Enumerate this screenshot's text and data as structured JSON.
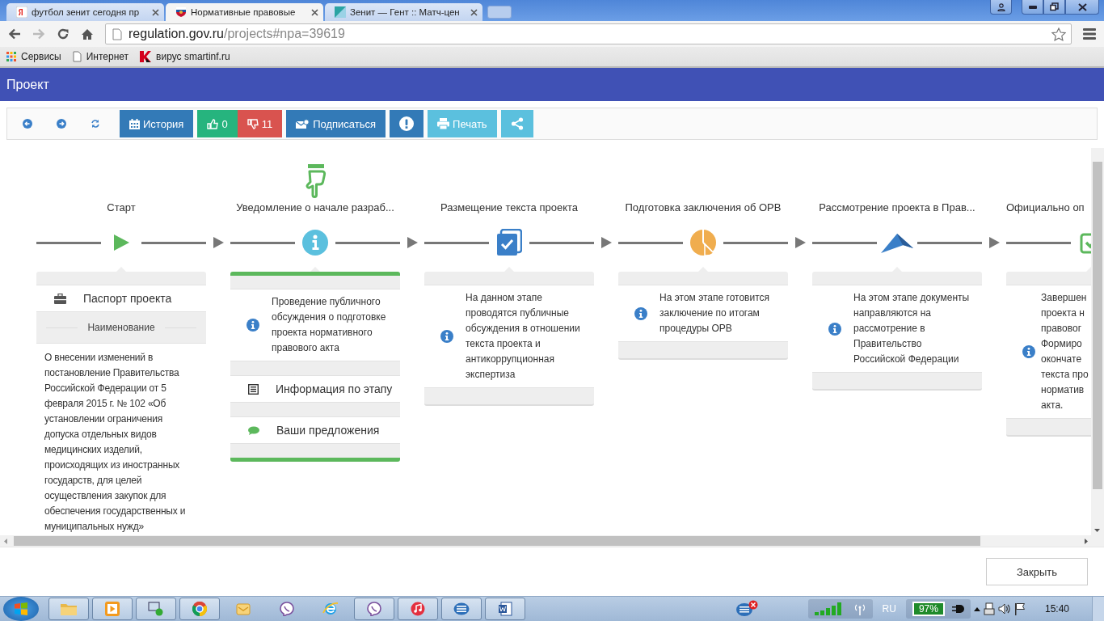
{
  "browser": {
    "tabs": [
      {
        "title": "футбол зенит сегодня пр",
        "selected": false
      },
      {
        "title": "Нормативные правовые",
        "selected": true
      },
      {
        "title": "Зенит — Гент :: Матч-цен",
        "selected": false
      }
    ],
    "url_host": "regulation.gov.ru",
    "url_path": "/projects#npa=39619",
    "bookmarks": [
      {
        "label": "Сервисы",
        "kind": "apps"
      },
      {
        "label": "Интернет",
        "kind": "page"
      },
      {
        "label": "вирус smartinf.ru",
        "kind": "kaspersky"
      }
    ]
  },
  "header": {
    "title": "Проект"
  },
  "toolbar": [
    {
      "kind": "back"
    },
    {
      "kind": "forward"
    },
    {
      "kind": "refresh"
    },
    {
      "kind": "history",
      "label": "История"
    },
    {
      "kind": "like",
      "label": "0"
    },
    {
      "kind": "dislike",
      "label": "11"
    },
    {
      "kind": "subscribe",
      "label": "Подписаться"
    },
    {
      "kind": "alert"
    },
    {
      "kind": "print",
      "label": "Печать"
    },
    {
      "kind": "share"
    }
  ],
  "stages": [
    {
      "title": "Старт",
      "current": false,
      "card": {
        "kind": "passport",
        "heading": "Паспорт проекта",
        "section": "Наименование",
        "text": "О внесении изменений в постановление Правительства Российской Федерации от 5 февраля 2015 г. № 102 «Об установлении ограничения допуска отдельных видов медицинских изделий, происходящих из иностранных государств, для целей осуществления закупок для обеспечения государственных и муниципальных нужд»"
      }
    },
    {
      "title": "Уведомление о начале разраб...",
      "current": true,
      "card": {
        "kind": "active",
        "text": "Проведение публичного обсуждения о подготовке проекта нормативного правового акта",
        "links": [
          {
            "label": "Информация по этапу"
          },
          {
            "label": "Ваши предложения"
          }
        ]
      }
    },
    {
      "title": "Размещение текста проекта",
      "current": false,
      "card": {
        "kind": "info",
        "text": "На данном этапе проводятся публичные обсуждения в отношении текста проекта и антикоррупционная экспертиза"
      }
    },
    {
      "title": "Подготовка заключения об ОРВ",
      "current": false,
      "card": {
        "kind": "info",
        "text": "На этом этапе готовится заключение по итогам процедуры ОРВ"
      }
    },
    {
      "title": "Рассмотрение проекта в Прав...",
      "current": false,
      "card": {
        "kind": "info",
        "text": "На этом этапе документы направляются на рассмотрение в Правительство Российской Федерации"
      }
    },
    {
      "title": "Официально оп",
      "current": false,
      "card": {
        "kind": "cut",
        "lines": [
          "Завершен",
          "проекта н",
          "правовог",
          "Формиро",
          "окончате",
          "текста про",
          "норматив",
          "акта."
        ]
      }
    }
  ],
  "footer": {
    "close": "Закрыть"
  },
  "taskbar": {
    "apps": [
      {
        "kind": "folder",
        "open": true
      },
      {
        "kind": "player",
        "open": true
      },
      {
        "kind": "monitor",
        "open": true
      },
      {
        "kind": "wheel",
        "open": true
      },
      {
        "kind": "mail",
        "open": false
      },
      {
        "kind": "chat",
        "open": false
      },
      {
        "kind": "globe",
        "open": false
      },
      {
        "kind": "chat",
        "open": true
      },
      {
        "kind": "music",
        "open": true
      },
      {
        "kind": "list",
        "open": true
      },
      {
        "kind": "document",
        "open": true
      }
    ],
    "language": "RU",
    "battery": "97%",
    "time": "15:40"
  }
}
